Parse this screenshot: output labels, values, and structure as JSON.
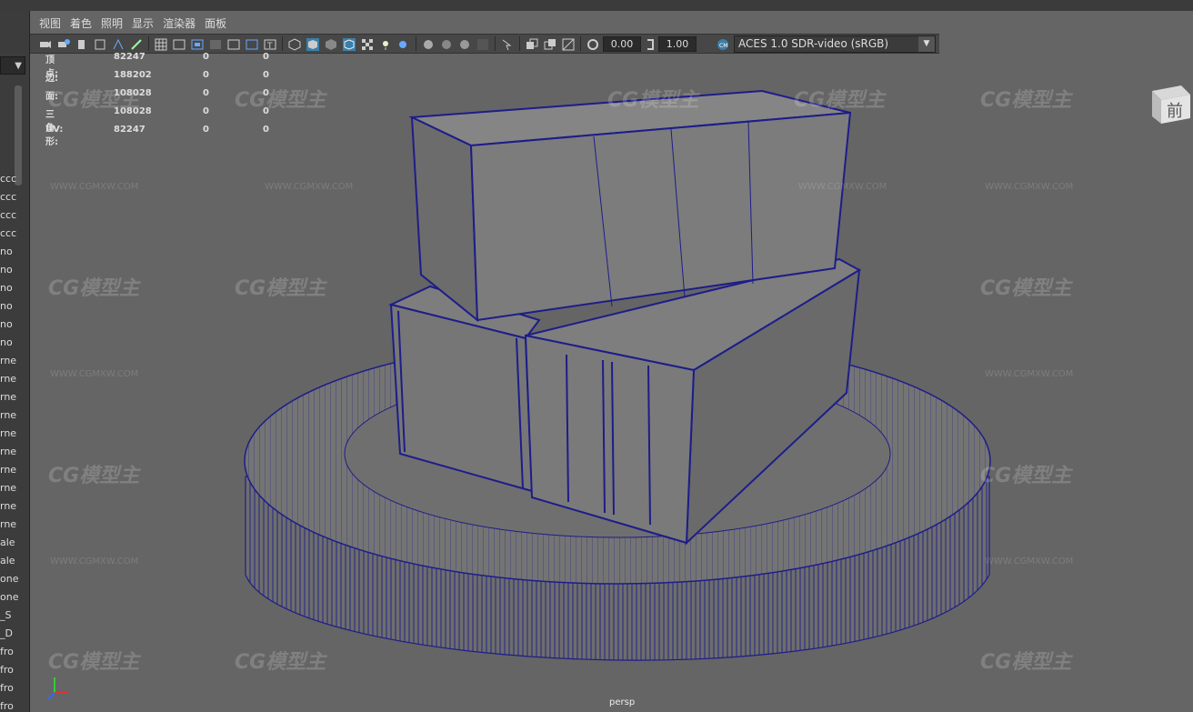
{
  "menu": {
    "items": [
      "视图",
      "着色",
      "照明",
      "显示",
      "渲染器",
      "面板"
    ]
  },
  "toolbar": {
    "value_a": "0.00",
    "value_b": "1.00",
    "color_space": "ACES 1.0 SDR-video (sRGB)"
  },
  "hud": {
    "rows": [
      {
        "label": "顶点:",
        "v1": "82247",
        "v2": "0",
        "v3": "0"
      },
      {
        "label": "边:",
        "v1": "188202",
        "v2": "0",
        "v3": "0"
      },
      {
        "label": "面:",
        "v1": "108028",
        "v2": "0",
        "v3": "0"
      },
      {
        "label": "三角形:",
        "v1": "108028",
        "v2": "0",
        "v3": "0"
      },
      {
        "label": "UV:",
        "v1": "82247",
        "v2": "0",
        "v3": "0"
      }
    ]
  },
  "viewcube": {
    "face": "前"
  },
  "camera": {
    "name": "persp"
  },
  "outliner": {
    "rows": [
      "ccc",
      "ccc",
      "ccc",
      "ccc",
      "no",
      "no",
      "no",
      "no",
      "no",
      "no",
      "rne",
      "rne",
      "rne",
      "rne",
      "rne",
      "rne",
      "rne",
      "rne",
      "rne",
      "rne",
      "ale",
      "ale",
      "one",
      "one",
      "_S",
      "_D",
      "fro",
      "fro",
      "fro",
      "fro"
    ]
  },
  "watermark": {
    "logo": "CG模型主",
    "url": "WWW.CGMXW.COM"
  },
  "colors": {
    "wire": "#1d1d8a",
    "viewport_bg": "#656565",
    "mesh": "#7a7a7a"
  }
}
